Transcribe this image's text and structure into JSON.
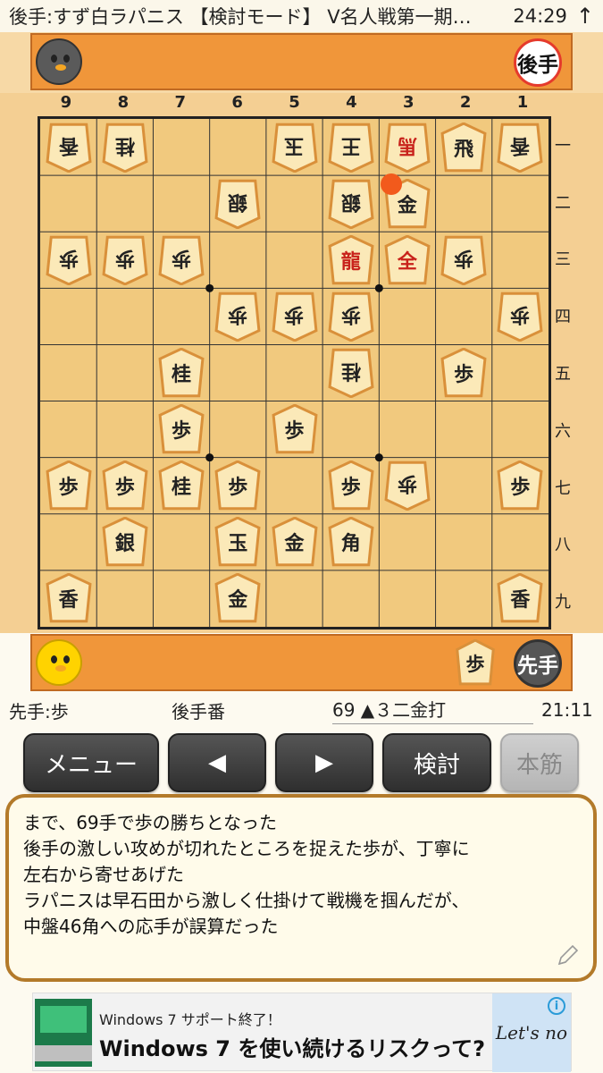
{
  "status_bar": {
    "title": "後手:すず白ラパニス 【検討モード】 V名人戦第一期…",
    "time": "24:29"
  },
  "board": {
    "files": [
      "9",
      "8",
      "7",
      "6",
      "5",
      "4",
      "3",
      "2",
      "1"
    ],
    "ranks": [
      "一",
      "二",
      "三",
      "四",
      "五",
      "六",
      "七",
      "八",
      "九"
    ],
    "pieces": [
      {
        "file": 9,
        "rank": 1,
        "kanji": "香",
        "owner": "gote"
      },
      {
        "file": 8,
        "rank": 1,
        "kanji": "桂",
        "owner": "gote"
      },
      {
        "file": 5,
        "rank": 1,
        "kanji": "玉",
        "owner": "gote"
      },
      {
        "file": 4,
        "rank": 1,
        "kanji": "王",
        "owner": "gote"
      },
      {
        "file": 3,
        "rank": 1,
        "kanji": "馬",
        "owner": "gote",
        "promoted": true
      },
      {
        "file": 2,
        "rank": 1,
        "kanji": "飛",
        "owner": "sente"
      },
      {
        "file": 1,
        "rank": 1,
        "kanji": "香",
        "owner": "gote"
      },
      {
        "file": 6,
        "rank": 2,
        "kanji": "銀",
        "owner": "gote"
      },
      {
        "file": 4,
        "rank": 2,
        "kanji": "銀",
        "owner": "gote"
      },
      {
        "file": 3,
        "rank": 2,
        "kanji": "金",
        "owner": "sente"
      },
      {
        "file": 9,
        "rank": 3,
        "kanji": "歩",
        "owner": "gote"
      },
      {
        "file": 8,
        "rank": 3,
        "kanji": "歩",
        "owner": "gote"
      },
      {
        "file": 7,
        "rank": 3,
        "kanji": "歩",
        "owner": "gote"
      },
      {
        "file": 4,
        "rank": 3,
        "kanji": "龍",
        "owner": "sente",
        "promoted": true
      },
      {
        "file": 3,
        "rank": 3,
        "kanji": "全",
        "owner": "sente",
        "promoted": true
      },
      {
        "file": 2,
        "rank": 3,
        "kanji": "歩",
        "owner": "gote"
      },
      {
        "file": 6,
        "rank": 4,
        "kanji": "歩",
        "owner": "gote"
      },
      {
        "file": 5,
        "rank": 4,
        "kanji": "歩",
        "owner": "gote"
      },
      {
        "file": 4,
        "rank": 4,
        "kanji": "歩",
        "owner": "gote"
      },
      {
        "file": 1,
        "rank": 4,
        "kanji": "歩",
        "owner": "gote"
      },
      {
        "file": 7,
        "rank": 5,
        "kanji": "桂",
        "owner": "sente"
      },
      {
        "file": 4,
        "rank": 5,
        "kanji": "桂",
        "owner": "gote"
      },
      {
        "file": 2,
        "rank": 5,
        "kanji": "歩",
        "owner": "sente"
      },
      {
        "file": 7,
        "rank": 6,
        "kanji": "歩",
        "owner": "sente"
      },
      {
        "file": 5,
        "rank": 6,
        "kanji": "歩",
        "owner": "sente"
      },
      {
        "file": 9,
        "rank": 7,
        "kanji": "歩",
        "owner": "sente"
      },
      {
        "file": 8,
        "rank": 7,
        "kanji": "歩",
        "owner": "sente"
      },
      {
        "file": 7,
        "rank": 7,
        "kanji": "桂",
        "owner": "sente"
      },
      {
        "file": 6,
        "rank": 7,
        "kanji": "歩",
        "owner": "sente"
      },
      {
        "file": 4,
        "rank": 7,
        "kanji": "歩",
        "owner": "sente"
      },
      {
        "file": 3,
        "rank": 7,
        "kanji": "歩",
        "owner": "gote"
      },
      {
        "file": 1,
        "rank": 7,
        "kanji": "歩",
        "owner": "sente"
      },
      {
        "file": 8,
        "rank": 8,
        "kanji": "銀",
        "owner": "sente"
      },
      {
        "file": 6,
        "rank": 8,
        "kanji": "玉",
        "owner": "sente"
      },
      {
        "file": 5,
        "rank": 8,
        "kanji": "金",
        "owner": "sente"
      },
      {
        "file": 4,
        "rank": 8,
        "kanji": "角",
        "owner": "sente"
      },
      {
        "file": 9,
        "rank": 9,
        "kanji": "香",
        "owner": "sente"
      },
      {
        "file": 6,
        "rank": 9,
        "kanji": "金",
        "owner": "sente"
      },
      {
        "file": 1,
        "rank": 9,
        "kanji": "香",
        "owner": "sente"
      }
    ],
    "last_move": {
      "file": 3,
      "rank": 2
    },
    "board_color": "#f1c97e"
  },
  "gote_hand": {
    "badge": "後手",
    "pieces": []
  },
  "sente_hand": {
    "badge": "先手",
    "pieces": [
      "歩"
    ]
  },
  "info": {
    "captured": "先手:歩",
    "turn": "後手番",
    "move": "69 ▲３二金打",
    "clock": "21:11"
  },
  "buttons": {
    "menu": "メニュー",
    "prev": "◀",
    "next": "▶",
    "analyze": "検討",
    "main_line": "本筋"
  },
  "comment": [
    "まで、69手で歩の勝ちとなった",
    "後手の激しい攻めが切れたところを捉えた歩が、丁寧に",
    "左右から寄せあげた",
    "ラパニスは早石田から激しく仕掛けて戦機を掴んだが、",
    "中盤46角への応手が誤算だった"
  ],
  "ad": {
    "small": "Windows 7 サポート終了！",
    "big": "Windows 7 を使い続けるリスクって?",
    "logo": "Let's no",
    "info": "i"
  }
}
